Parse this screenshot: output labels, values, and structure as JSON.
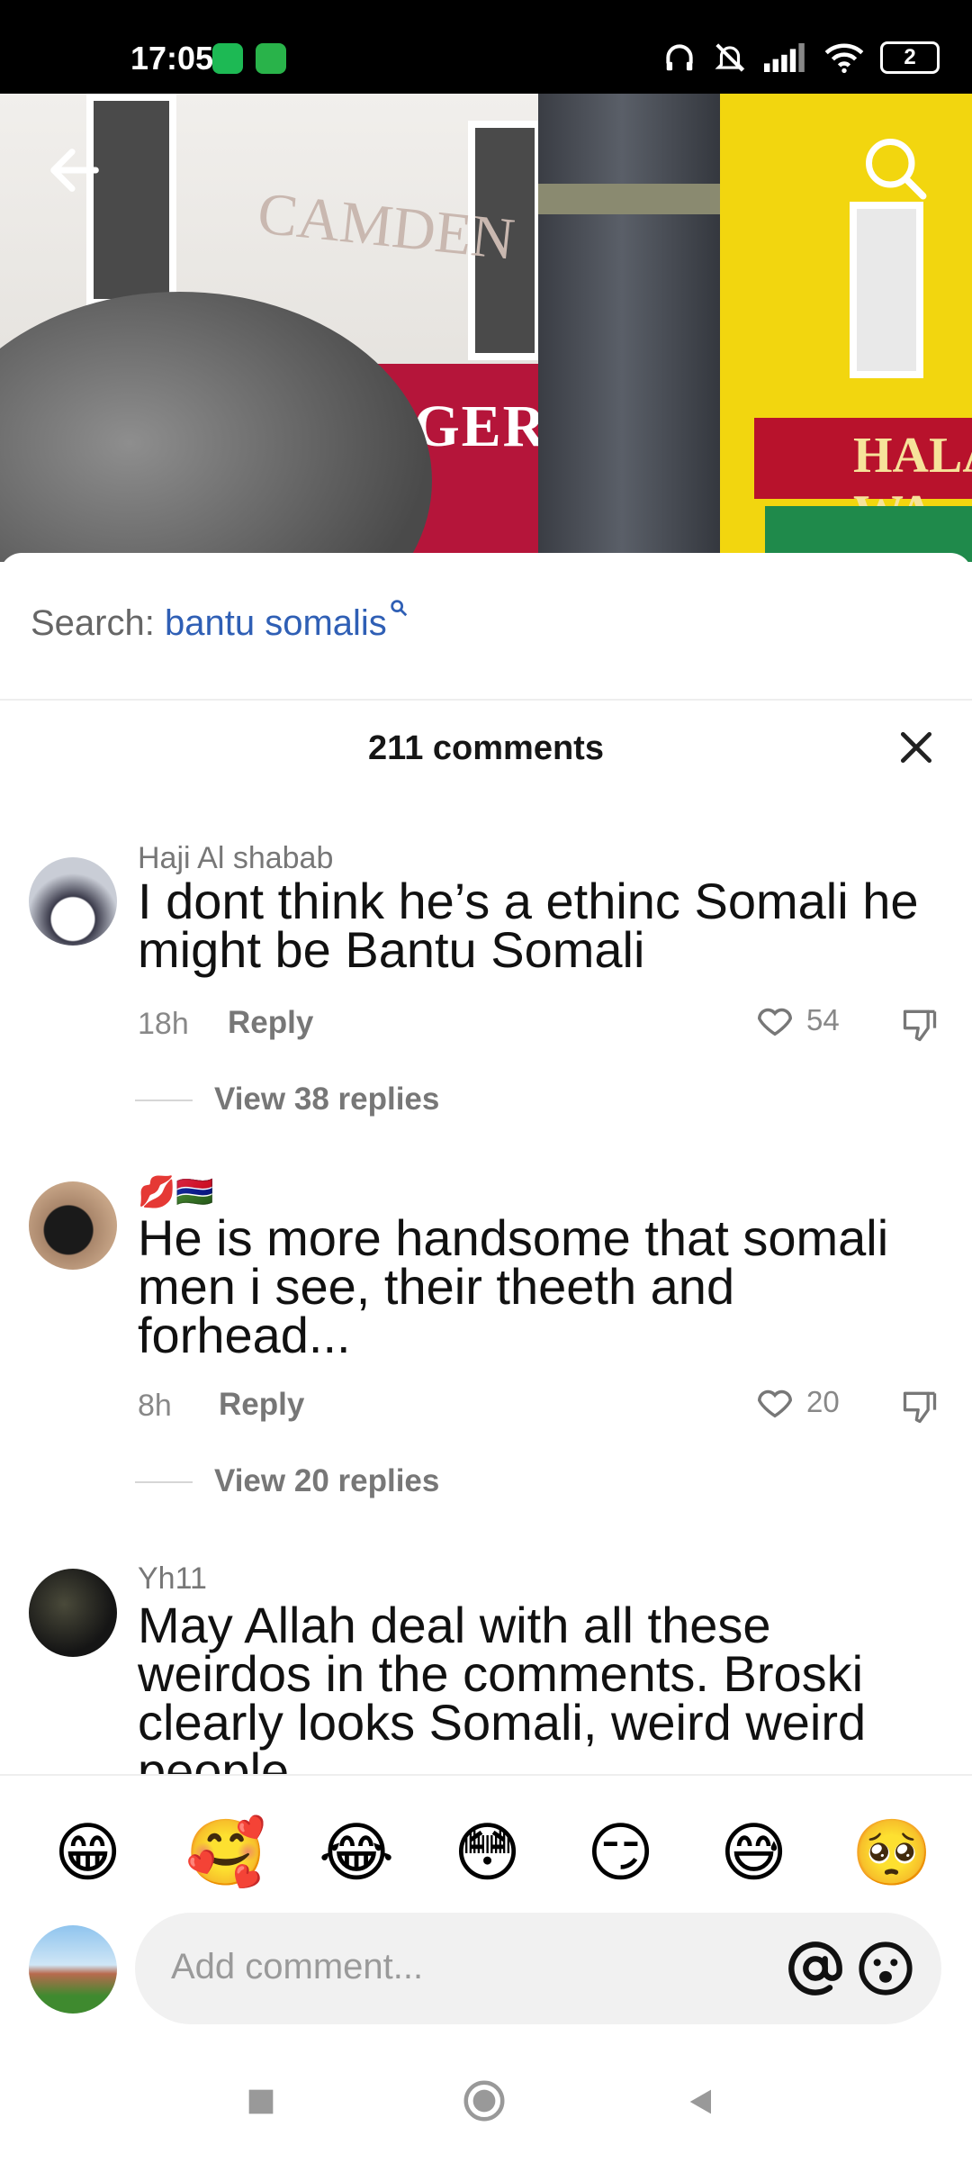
{
  "status_bar": {
    "time": "17:05",
    "battery": "2"
  },
  "video": {
    "sign_text": "ANGER ★",
    "camden_text": "CAMDEN",
    "hala_text": "HALA WA"
  },
  "search": {
    "prefix": "Search:",
    "query": "bantu somalis"
  },
  "comments_header": {
    "title": "211 comments"
  },
  "comments": [
    {
      "author": "Haji Al shabab",
      "text": "I dont think he’s a ethinc Somali he might be Bantu Somali",
      "time": "18h",
      "reply_label": "Reply",
      "likes": "54",
      "view_replies": "View 38 replies"
    },
    {
      "author": "💋🇬🇲",
      "text": "He is more handsome that somali men i see, their theeth and forhead...",
      "time": "8h",
      "reply_label": "Reply",
      "likes": "20",
      "view_replies": "View 20 replies"
    },
    {
      "author": "Yh11",
      "text": "May Allah deal with all these weirdos in the comments. Broski clearly looks Somali, weird weird people"
    }
  ],
  "emoji_bar": [
    "😁",
    "🥰",
    "😂",
    "😳",
    "😏",
    "😅",
    "🥺"
  ],
  "composer": {
    "placeholder": "Add comment..."
  },
  "colors": {
    "accent_link": "#2f5fb5",
    "status_bg": "#000000"
  }
}
